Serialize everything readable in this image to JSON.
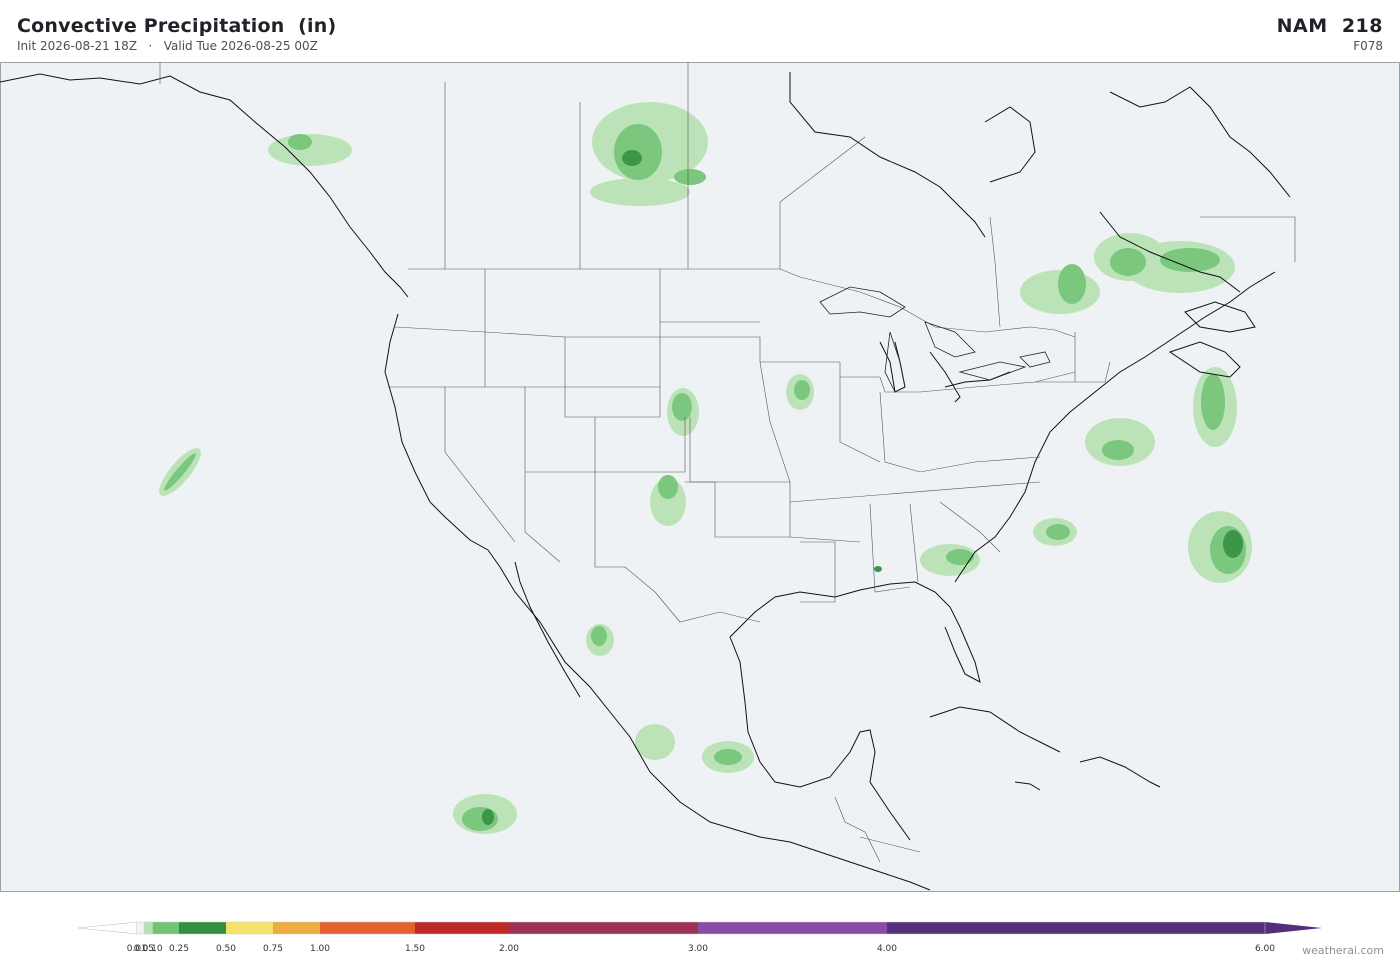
{
  "header": {
    "title": "Convective Precipitation  (in)",
    "subtitle": "Init 2026-08-21 18Z   ·   Valid Tue 2026-08-25 00Z",
    "model": "NAM  218",
    "forecast_hour": "F078"
  },
  "map": {
    "background_color": "#eef2f5",
    "coastline_color": "#111111",
    "border_color": "#555555"
  },
  "colorbar": {
    "ticks": [
      {
        "value": 0.01,
        "label": "0.01"
      },
      {
        "value": 0.05,
        "label": "0.05"
      },
      {
        "value": 0.1,
        "label": "0.10"
      },
      {
        "value": 0.25,
        "label": "0.25"
      },
      {
        "value": 0.5,
        "label": "0.50"
      },
      {
        "value": 0.75,
        "label": "0.75"
      },
      {
        "value": 1.0,
        "label": "1.00"
      },
      {
        "value": 1.5,
        "label": "1.50"
      },
      {
        "value": 2.0,
        "label": "2.00"
      },
      {
        "value": 3.0,
        "label": "3.00"
      },
      {
        "value": 4.0,
        "label": "4.00"
      },
      {
        "value": 6.0,
        "label": "6.00"
      }
    ],
    "bins": [
      {
        "from": 0.01,
        "to": 0.05,
        "color": "#eef6ee"
      },
      {
        "from": 0.05,
        "to": 0.1,
        "color": "#b9e2b4"
      },
      {
        "from": 0.1,
        "to": 0.25,
        "color": "#74c476"
      },
      {
        "from": 0.25,
        "to": 0.5,
        "color": "#31913f"
      },
      {
        "from": 0.5,
        "to": 0.75,
        "color": "#f4e36a"
      },
      {
        "from": 0.75,
        "to": 1.0,
        "color": "#eeab3f"
      },
      {
        "from": 1.0,
        "to": 1.5,
        "color": "#e4622f"
      },
      {
        "from": 1.5,
        "to": 2.0,
        "color": "#c02a27"
      },
      {
        "from": 2.0,
        "to": 3.0,
        "color": "#9e3455"
      },
      {
        "from": 3.0,
        "to": 4.0,
        "color": "#8b4aa6"
      },
      {
        "from": 4.0,
        "to": 6.0,
        "color": "#54307a"
      }
    ],
    "under_color": "#ffffff",
    "over_color": "#54307a"
  },
  "credit": "weatherai.com"
}
